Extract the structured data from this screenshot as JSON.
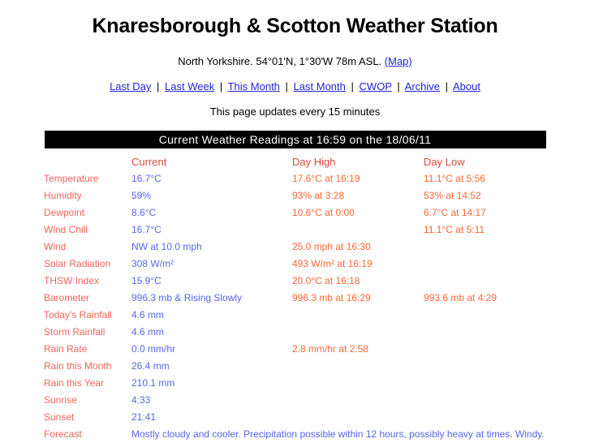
{
  "header": {
    "title": "Knaresborough & Scotton Weather Station",
    "location": "North Yorkshire. 54°01'N, 1°30'W 78m ASL.",
    "map_link": "(Map)",
    "update_note": "This page updates every 15 minutes",
    "nav": [
      {
        "label": "Last Day"
      },
      {
        "label": "Last Week"
      },
      {
        "label": "This Month"
      },
      {
        "label": "Last Month"
      },
      {
        "label": "CWOP"
      },
      {
        "label": "Archive"
      },
      {
        "label": "About"
      }
    ],
    "nav_separator": "|"
  },
  "readings": {
    "bar_title": "Current Weather Readings at 16:59 on the 18/06/11",
    "columns": [
      "",
      "Current",
      "Day High",
      "Day Low"
    ],
    "rows": [
      {
        "label": "Temperature",
        "current": "16.7°C",
        "high": "17.6°C at 16:19",
        "low": "11.1°C at 5:56"
      },
      {
        "label": "Humidity",
        "current": "59%",
        "high": "93%  at 3:28",
        "low": "53%  at 14:52"
      },
      {
        "label": "Dewpoint",
        "current": "8.6°C",
        "high": "10.6°C at 0:00",
        "low": "6.7°C at 14:17"
      },
      {
        "label": "Wind Chill",
        "current": "16.7°C",
        "high": "",
        "low": "11.1°C at 5:11"
      },
      {
        "label": "Wind",
        "current": "NW at 10.0 mph",
        "high": "25.0 mph at 16:30",
        "low": ""
      },
      {
        "label": "Solar Radiation",
        "current": "308 W/m²",
        "high": "493 W/m² at 16:19",
        "low": ""
      },
      {
        "label": "THSW Index",
        "current": "15.9°C",
        "high": "20.0°C at 16:18",
        "low": ""
      },
      {
        "label": "Barometer",
        "current": "996.3 mb & Rising Slowly",
        "high": "996.3 mb at 16:29",
        "low": "993.6 mb at 4:29"
      },
      {
        "label": "Today's Rainfall",
        "current": "4.6 mm",
        "high": "",
        "low": ""
      },
      {
        "label": "Storm Rainfall",
        "current": "4.6 mm",
        "high": "",
        "low": ""
      },
      {
        "label": "Rain Rate",
        "current": "0.0 mm/hr",
        "high": "2.8 mm/hr at 2:58",
        "low": ""
      },
      {
        "label": "Rain this Month",
        "current": "26.4 mm",
        "high": "",
        "low": ""
      },
      {
        "label": "Rain this Year",
        "current": "210.1 mm",
        "high": "",
        "low": ""
      },
      {
        "label": "Sunrise",
        "current": "4:33",
        "high": "",
        "low": ""
      },
      {
        "label": "Sunset",
        "current": "21:41",
        "high": "",
        "low": ""
      },
      {
        "label": "Forecast",
        "current": "Mostly cloudy and cooler. Precipitation possible within 12 hours, possibly heavy at times. Windy.",
        "high": "",
        "low": ""
      }
    ]
  },
  "colors": {
    "label": "#f4645a",
    "current_value": "#5566ee",
    "extreme_value": "#ff6633",
    "link": "#2222dd",
    "bar_background": "#000000"
  }
}
